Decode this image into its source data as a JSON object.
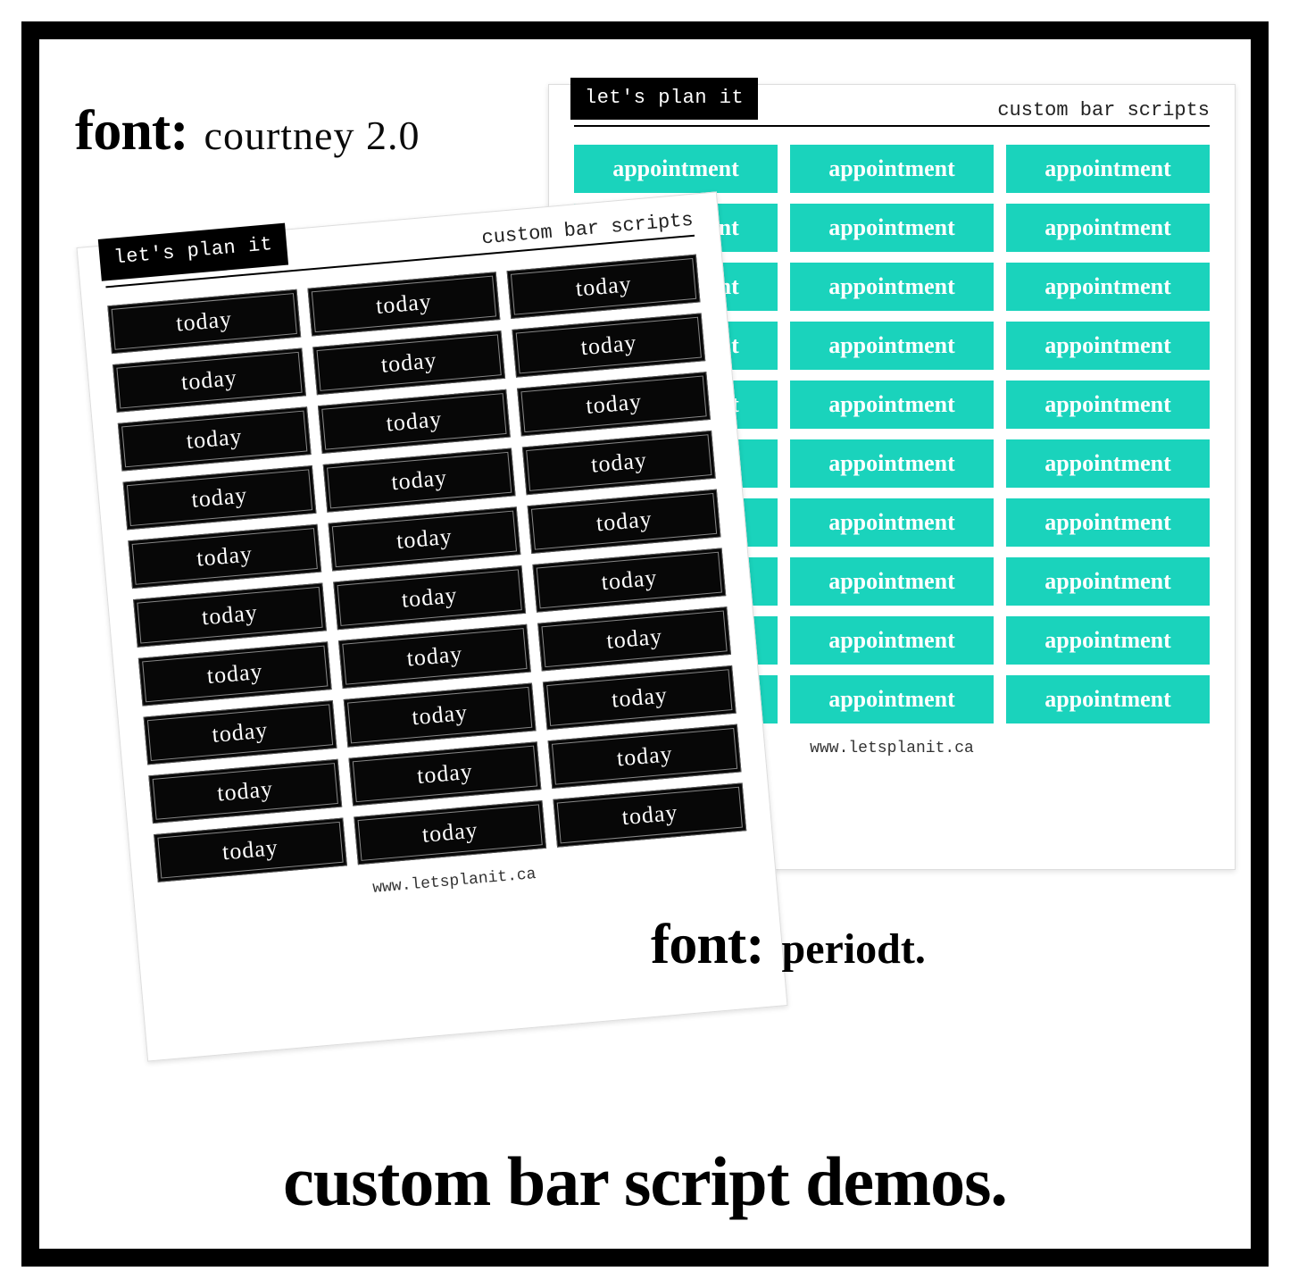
{
  "font_label_prefix": "font:",
  "font_left_name": "courtney 2.0",
  "font_right_name": "periodt.",
  "caption": "custom bar script demos.",
  "sheet": {
    "brand": "let's plan it",
    "subtitle": "custom bar scripts",
    "footer": "www.letsplanit.ca"
  },
  "teal": {
    "rows": 10,
    "cols": 3,
    "label": "appointment",
    "color": "#1ad3bc"
  },
  "black": {
    "rows": 10,
    "cols": 3,
    "label": "today",
    "color": "#070707"
  }
}
